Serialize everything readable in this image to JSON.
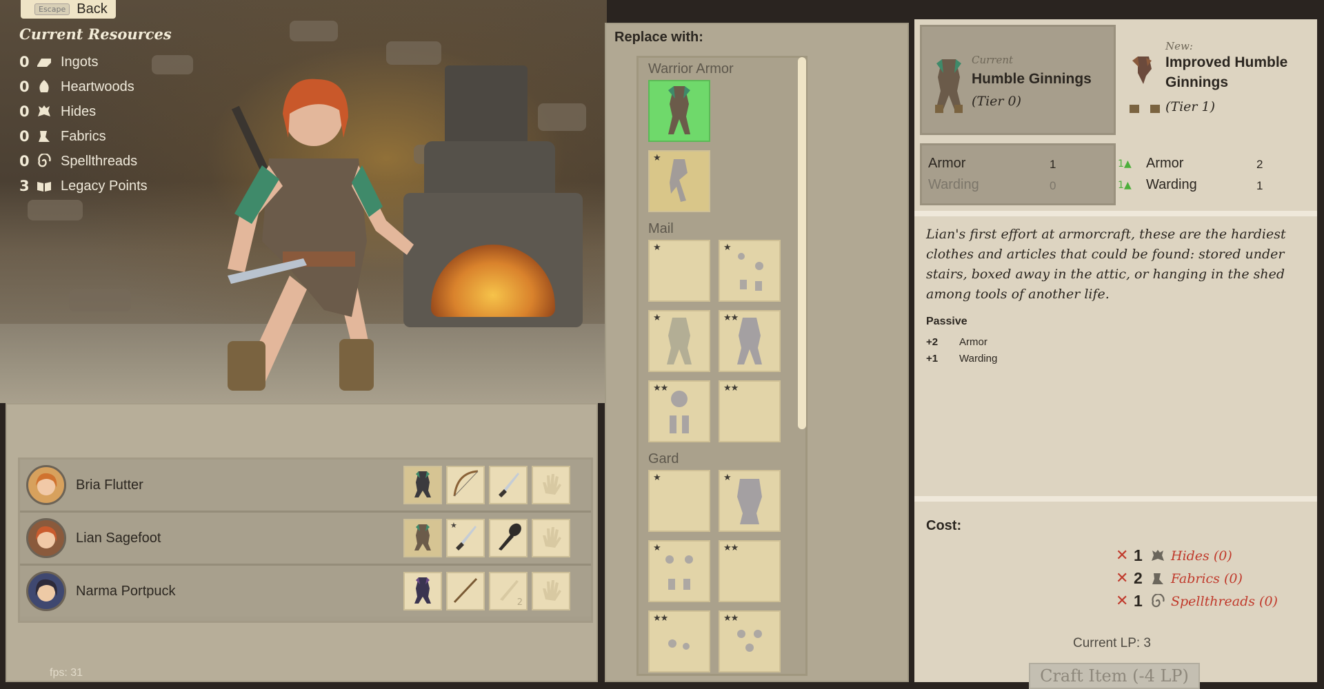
{
  "back": {
    "key": "Escape",
    "label": "Back"
  },
  "resources": {
    "title": "Current Resources",
    "items": [
      {
        "count": "0",
        "label": "Ingots",
        "icon": "ingot-icon"
      },
      {
        "count": "0",
        "label": "Heartwoods",
        "icon": "heartwood-icon"
      },
      {
        "count": "0",
        "label": "Hides",
        "icon": "hide-icon"
      },
      {
        "count": "0",
        "label": "Fabrics",
        "icon": "fabric-icon"
      },
      {
        "count": "0",
        "label": "Spellthreads",
        "icon": "spellthread-icon"
      },
      {
        "count": "3",
        "label": "Legacy Points",
        "icon": "book-icon"
      }
    ]
  },
  "party": [
    {
      "name": "Bria Flutter",
      "slots": [
        "armor-icon",
        "bow-icon",
        "dagger-icon",
        "hand-icon"
      ]
    },
    {
      "name": "Lian Sagefoot",
      "slots": [
        "armor-icon",
        "dagger-icon",
        "club-icon",
        "hand-icon"
      ]
    },
    {
      "name": "Narma Portpuck",
      "slots": [
        "armor-icon",
        "staff-icon",
        "sword-icon",
        "hand-icon"
      ],
      "badge": "2"
    }
  ],
  "replace": {
    "title": "Replace with:",
    "categories": [
      {
        "label": "Warrior Armor",
        "tiles": [
          {
            "stars": "",
            "state": "selected"
          },
          {
            "stars": "★",
            "state": "owned"
          }
        ]
      },
      {
        "label": "Mail",
        "tiles": [
          {
            "stars": "★"
          },
          {
            "stars": "★"
          },
          {
            "stars": "★"
          },
          {
            "stars": "★★"
          },
          {
            "stars": "★★"
          },
          {
            "stars": "★★"
          }
        ]
      },
      {
        "label": "Gard",
        "tiles": [
          {
            "stars": "★"
          },
          {
            "stars": "★"
          },
          {
            "stars": "★"
          },
          {
            "stars": "★★"
          },
          {
            "stars": "★★"
          },
          {
            "stars": "★★"
          }
        ]
      }
    ]
  },
  "detail": {
    "current": {
      "tag": "Current",
      "name": "Humble Ginnings",
      "tier": "(Tier 0)"
    },
    "new": {
      "tag": "New:",
      "name_line1": "Improved Humble",
      "name_line2": "Ginnings",
      "tier": "(Tier 1)"
    },
    "stats_current": [
      {
        "label": "Armor",
        "value": "1"
      },
      {
        "label": "Warding",
        "value": "0"
      }
    ],
    "stats_new": [
      {
        "delta": "1",
        "label": "Armor",
        "value": "2"
      },
      {
        "delta": "1",
        "label": "Warding",
        "value": "1"
      }
    ],
    "description": "Lian's first effort at armorcraft, these are the hardiest clothes and articles that could be found: stored under stairs, boxed away in the attic, or hanging in the shed among tools of another life.",
    "passive": {
      "title": "Passive",
      "rows": [
        {
          "value": "+2",
          "label": "Armor"
        },
        {
          "value": "+1",
          "label": "Warding"
        }
      ]
    },
    "cost": {
      "title": "Cost:",
      "items": [
        {
          "mark": "✕",
          "amount": "1",
          "label": "Hides (0)"
        },
        {
          "mark": "✕",
          "amount": "2",
          "label": "Fabrics (0)"
        },
        {
          "mark": "✕",
          "amount": "1",
          "label": "Spellthreads (0)"
        }
      ]
    },
    "current_lp": "Current LP: 3",
    "craft_button": "Craft Item (-4 LP)"
  },
  "fps": "fps: 31",
  "colors": {
    "missing": "#c0392b",
    "upgrade": "#4caf3b",
    "selected_tile": "#6fd96b"
  }
}
